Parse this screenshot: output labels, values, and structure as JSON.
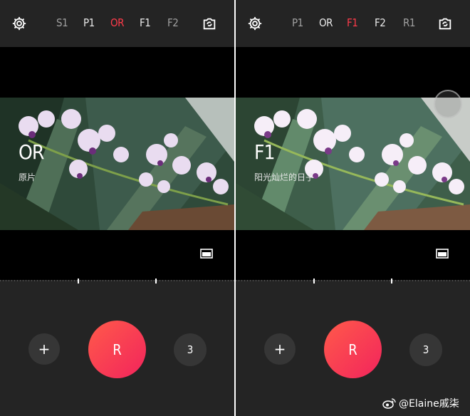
{
  "left": {
    "tabs": [
      {
        "label": "S1",
        "active": false
      },
      {
        "label": "P1",
        "active": false
      },
      {
        "label": "OR",
        "active": true
      },
      {
        "label": "F1",
        "active": false
      },
      {
        "label": "F2",
        "active": false
      }
    ],
    "filter": {
      "name": "OR",
      "subtitle": "原片"
    },
    "controls": {
      "plus": "+",
      "shutter": "R",
      "count": "3"
    }
  },
  "right": {
    "tabs": [
      {
        "label": "P1",
        "active": false
      },
      {
        "label": "OR",
        "active": false
      },
      {
        "label": "F1",
        "active": true
      },
      {
        "label": "F2",
        "active": false
      },
      {
        "label": "R1",
        "active": false
      }
    ],
    "filter": {
      "name": "F1",
      "subtitle": "阳光灿烂的日子"
    },
    "controls": {
      "plus": "+",
      "shutter": "R",
      "count": "3"
    }
  },
  "watermark": "@Elaine戚柒",
  "colors": {
    "active_tab": "#ff3b4a",
    "tab": "#c8c8c8",
    "tab_dim": "#8a8a8a",
    "shutter": "#f5324f",
    "panel": "#242424"
  },
  "icons": {
    "settings": "gear-icon",
    "flip": "camera-flip-icon",
    "frame": "aspect-ratio-icon"
  }
}
